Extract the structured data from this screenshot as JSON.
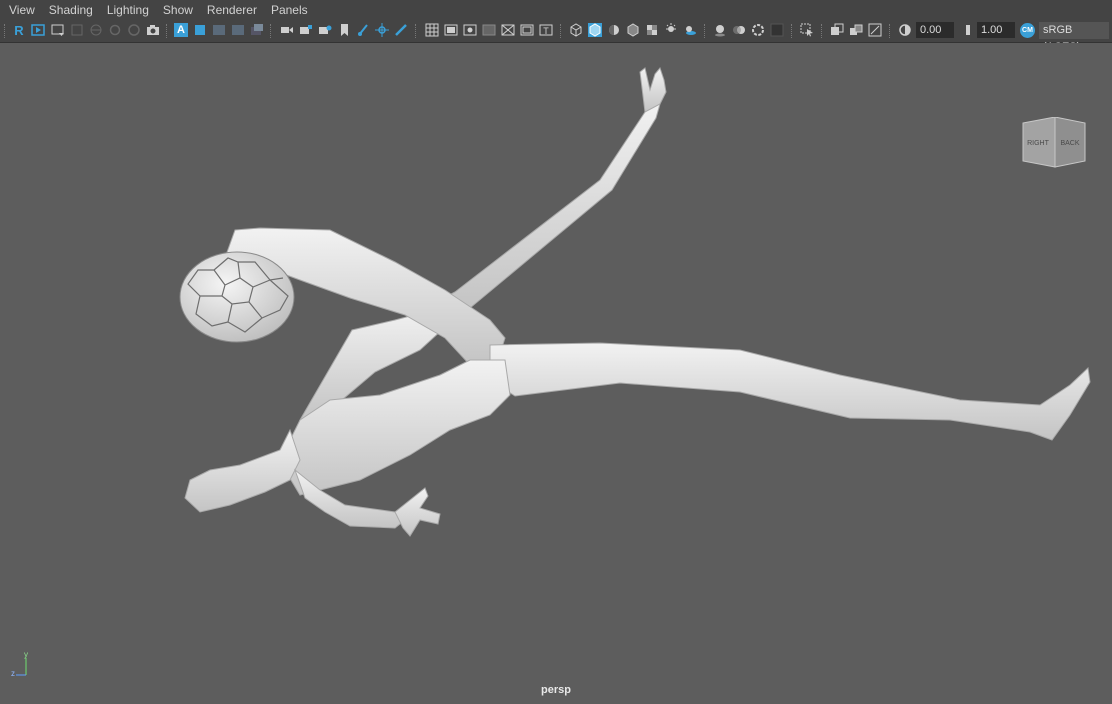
{
  "menus": [
    "View",
    "Shading",
    "Lighting",
    "Show",
    "Renderer",
    "Panels"
  ],
  "toolbar": {
    "exposure_value": "0.00",
    "gamma_value": "1.00",
    "color_space": "sRGB (ACES)",
    "renderer_badge": "R",
    "ao_badge": "A",
    "cm_badge": "CM"
  },
  "viewcube": {
    "face_right": "RIGHT",
    "face_back": "BACK"
  },
  "axis": {
    "y": "y",
    "z": "z"
  },
  "camera": {
    "name": "persp"
  },
  "colors": {
    "viewport_bg": "#5d5d5d",
    "toolbar_bg": "#444444",
    "accent_blue": "#3aa0d8",
    "model": "#e4e4e4"
  }
}
